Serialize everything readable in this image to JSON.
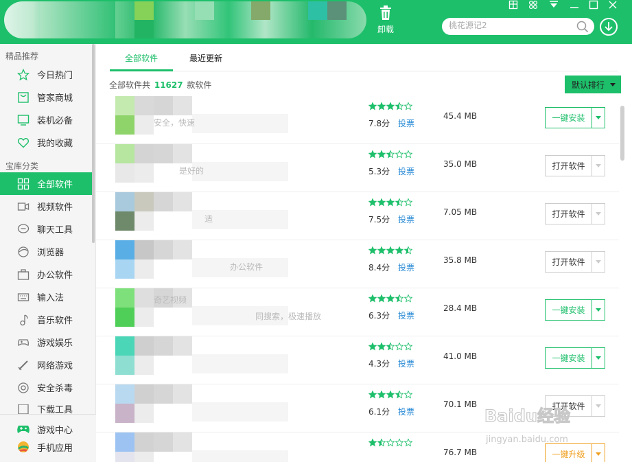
{
  "header": {
    "uninstall_label": "卸载",
    "search_placeholder": "桃花源记2"
  },
  "sidebar": {
    "section1_title": "精品推荐",
    "section1_items": [
      {
        "label": "今日热门",
        "icon": "star-icon"
      },
      {
        "label": "管家商城",
        "icon": "shop-icon"
      },
      {
        "label": "装机必备",
        "icon": "monitor-icon"
      },
      {
        "label": "我的收藏",
        "icon": "heart-icon"
      }
    ],
    "section2_title": "宝库分类",
    "section2_items": [
      {
        "label": "全部软件",
        "icon": "grid-icon",
        "active": true
      },
      {
        "label": "视频软件",
        "icon": "video-icon"
      },
      {
        "label": "聊天工具",
        "icon": "chat-icon"
      },
      {
        "label": "浏览器",
        "icon": "browser-icon"
      },
      {
        "label": "办公软件",
        "icon": "briefcase-icon"
      },
      {
        "label": "输入法",
        "icon": "keyboard-icon"
      },
      {
        "label": "音乐软件",
        "icon": "music-icon"
      },
      {
        "label": "游戏娱乐",
        "icon": "gamepad-icon"
      },
      {
        "label": "网络游戏",
        "icon": "sword-icon"
      },
      {
        "label": "安全杀毒",
        "icon": "shield-icon"
      },
      {
        "label": "下载工具",
        "icon": "download-icon"
      }
    ],
    "bottom_items": [
      {
        "label": "游戏中心",
        "icon": "game-center-icon"
      },
      {
        "label": "手机应用",
        "icon": "mobile-app-icon"
      }
    ]
  },
  "main": {
    "tabs": [
      {
        "label": "全部软件",
        "active": true
      },
      {
        "label": "最近更新",
        "active": false
      }
    ],
    "summary_prefix": "全部软件共",
    "summary_count": "11627",
    "summary_suffix": "款软件",
    "sort_label": "默认排行",
    "rows": [
      {
        "rating": 3.5,
        "score": "7.8分",
        "vote": "投票",
        "size": "45.4 MB",
        "action": "一键安装",
        "action_type": "install",
        "fragments": [
          "安全，快速"
        ],
        "thumb_colors": [
          "#c5eab0",
          "#8fd36b",
          "#d9d9d9"
        ]
      },
      {
        "rating": 2.5,
        "score": "5.3分",
        "vote": "投票",
        "size": "35.0 MB",
        "action": "打开软件",
        "action_type": "open",
        "fragments": [
          "是好的"
        ],
        "thumb_colors": [
          "#b6e6a0",
          "#e8e8e8",
          "#d4d4d4"
        ]
      },
      {
        "rating": 3.5,
        "score": "7.5分",
        "vote": "投票",
        "size": "7.05 MB",
        "action": "打开软件",
        "action_type": "open",
        "fragments": [
          "适"
        ],
        "thumb_colors": [
          "#a9c9dc",
          "#6f8a6a",
          "#c9c9bd"
        ]
      },
      {
        "rating": 4.5,
        "score": "8.4分",
        "vote": "投票",
        "size": "35.8 MB",
        "action": "打开软件",
        "action_type": "open",
        "fragments": [
          "办公软件"
        ],
        "thumb_colors": [
          "#5aaee6",
          "#a8d6f2",
          "#c7c7c7"
        ]
      },
      {
        "rating": 3.5,
        "score": "6.3分",
        "vote": "投票",
        "size": "28.4 MB",
        "action": "一键安装",
        "action_type": "install",
        "fragments": [
          "奇艺视频",
          "同搜索，极速播放"
        ],
        "thumb_colors": [
          "#7ee07a",
          "#4fce58",
          "#dedede"
        ]
      },
      {
        "rating": 2.5,
        "score": "4.3分",
        "vote": "投票",
        "size": "41.0 MB",
        "action": "一键安装",
        "action_type": "install",
        "fragments": [],
        "thumb_colors": [
          "#4bd6b8",
          "#8fded2",
          "#cfcfcf"
        ]
      },
      {
        "rating": 3.5,
        "score": "6.1分",
        "vote": "投票",
        "size": "70.1 MB",
        "action": "打开软件",
        "action_type": "open",
        "fragments": [],
        "thumb_colors": [
          "#b9d9f0",
          "#c8b3c8",
          "#d0d0d0"
        ]
      },
      {
        "rating": 1.5,
        "score": "",
        "vote": "",
        "size": "76.7 MB",
        "action": "一键升级",
        "action_type": "upgrade",
        "fragments": [],
        "thumb_colors": [
          "#9cc3f2",
          "#e4e4ee",
          "#d2d2d2"
        ]
      }
    ]
  },
  "watermark": {
    "text_top": "Baidu经验",
    "text_bottom": "jingyan.baidu.com"
  },
  "colors": {
    "accent": "#1dbf6a",
    "link": "#2a8bd6",
    "upgrade": "#f0a020"
  }
}
